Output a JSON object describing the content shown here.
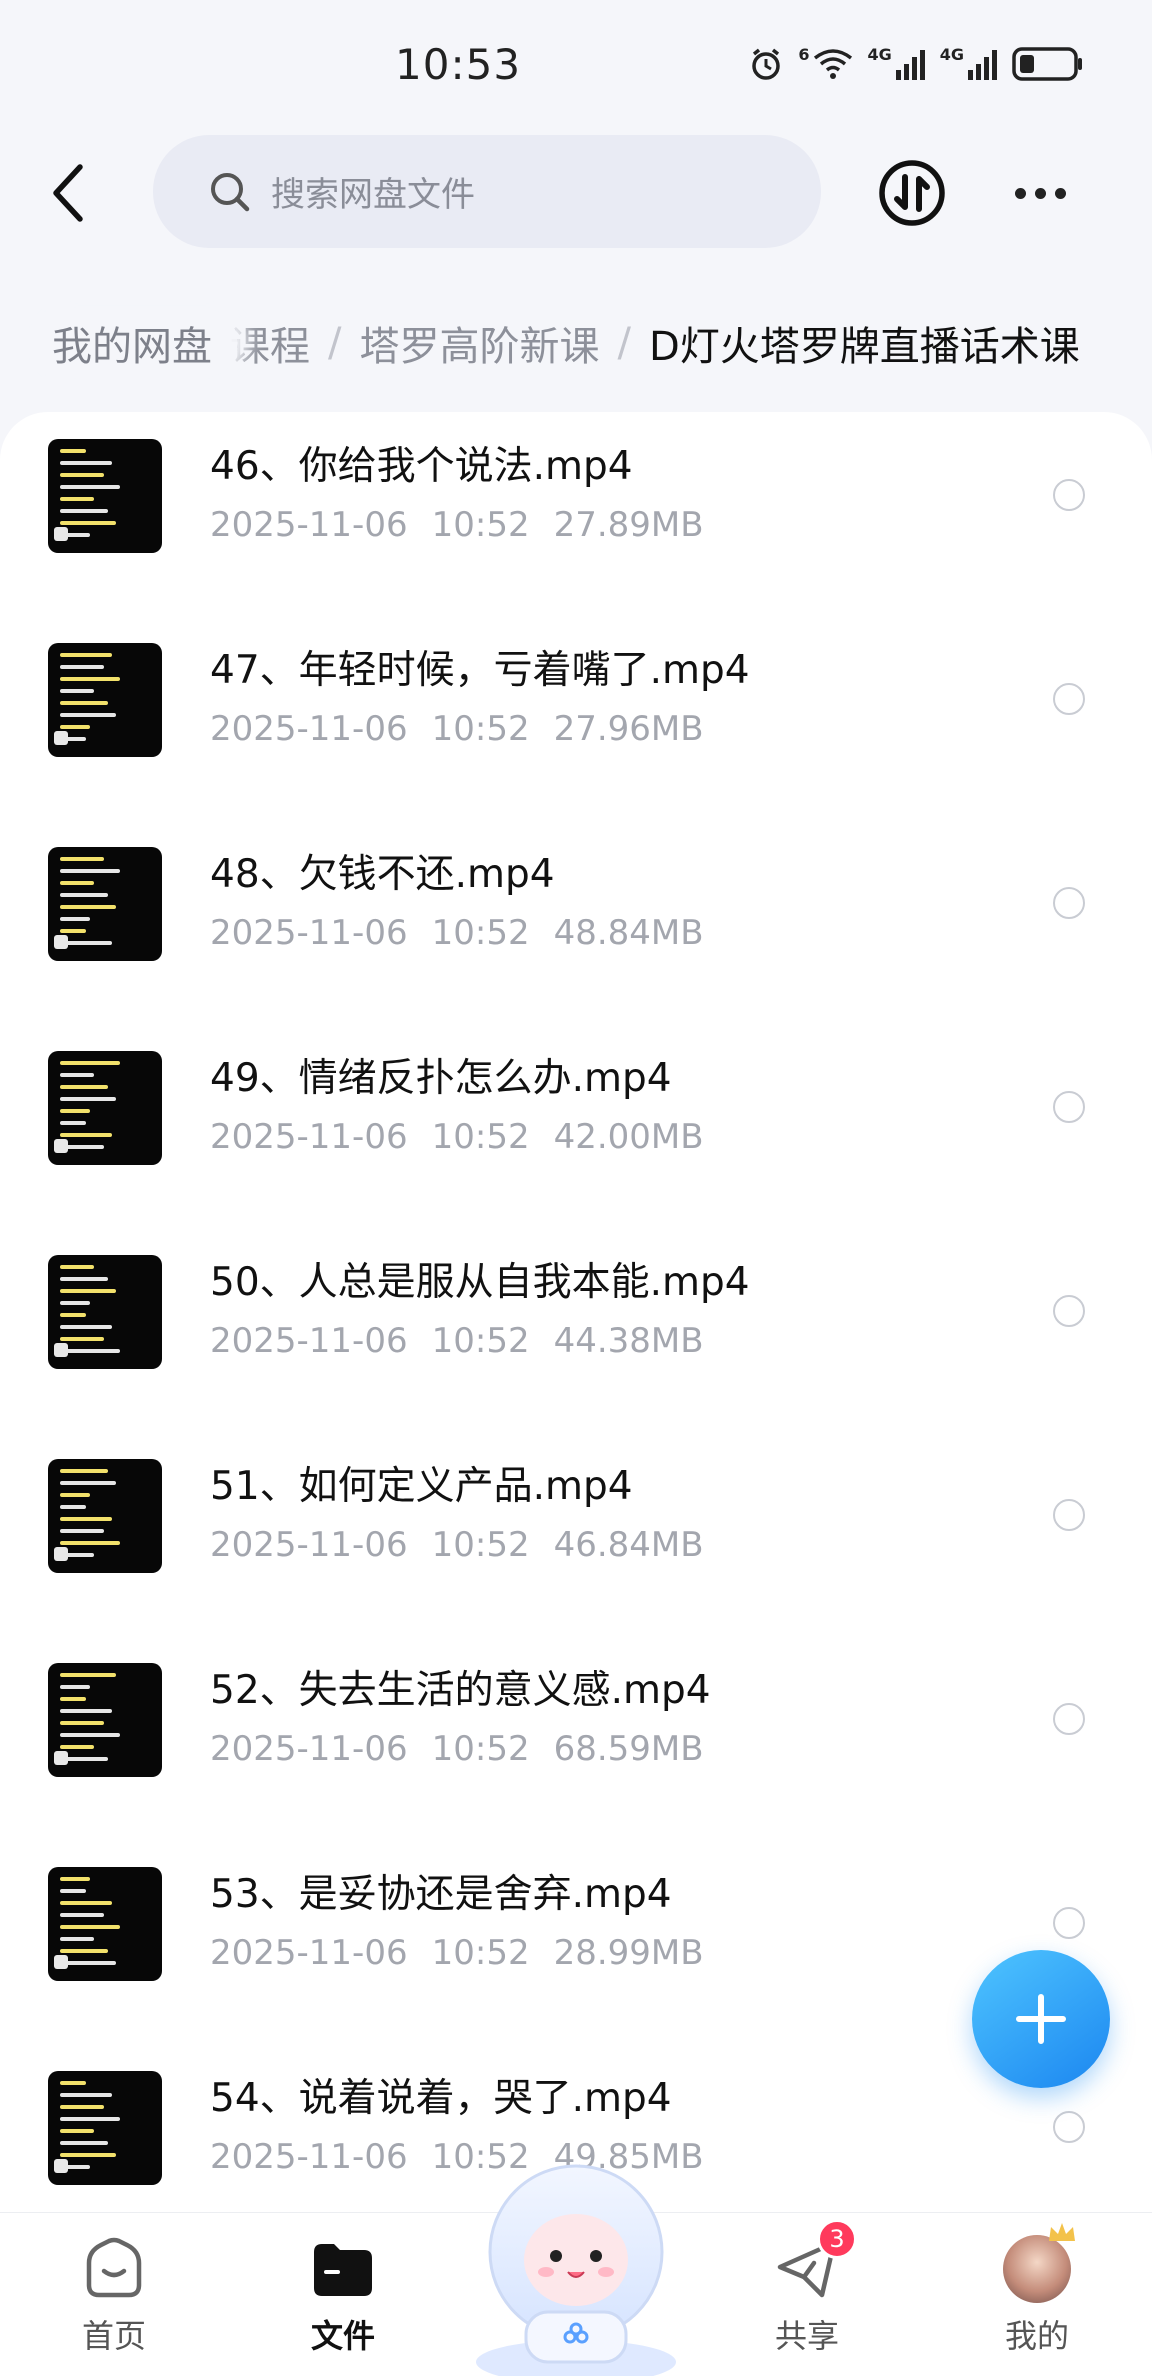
{
  "status_bar": {
    "time": "10:53",
    "network_1": "4G",
    "network_2": "4G",
    "wifi_label": "6",
    "icons": [
      "alarm-icon",
      "wifi-icon",
      "signal-icon",
      "signal-icon",
      "battery-icon"
    ]
  },
  "header": {
    "search_placeholder": "搜索网盘文件",
    "icons": [
      "back-arrow-icon",
      "search-icon",
      "transfer-icon",
      "more-icon"
    ]
  },
  "breadcrumb": {
    "root": "我的网盘",
    "trail_fragment": "课程",
    "separator": "/",
    "middle": "塔罗高阶新课",
    "current": "D灯火塔罗牌直播话术课"
  },
  "files": [
    {
      "name": "46、你给我个说法.mp4",
      "date": "2025-11-06",
      "time": "10:52",
      "size": "27.89MB"
    },
    {
      "name": "47、年轻时候，亏着嘴了.mp4",
      "date": "2025-11-06",
      "time": "10:52",
      "size": "27.96MB"
    },
    {
      "name": "48、欠钱不还.mp4",
      "date": "2025-11-06",
      "time": "10:52",
      "size": "48.84MB"
    },
    {
      "name": "49、情绪反扑怎么办.mp4",
      "date": "2025-11-06",
      "time": "10:52",
      "size": "42.00MB"
    },
    {
      "name": "50、人总是服从自我本能.mp4",
      "date": "2025-11-06",
      "time": "10:52",
      "size": "44.38MB"
    },
    {
      "name": "51、如何定义产品.mp4",
      "date": "2025-11-06",
      "time": "10:52",
      "size": "46.84MB"
    },
    {
      "name": "52、失去生活的意义感.mp4",
      "date": "2025-11-06",
      "time": "10:52",
      "size": "68.59MB"
    },
    {
      "name": "53、是妥协还是舍弃.mp4",
      "date": "2025-11-06",
      "time": "10:52",
      "size": "28.99MB"
    },
    {
      "name": "54、说着说着，哭了.mp4",
      "date": "2025-11-06",
      "time": "10:52",
      "size": "49.85MB"
    }
  ],
  "bottom_nav": {
    "items": [
      {
        "label": "首页",
        "icon": "home-icon",
        "active": false
      },
      {
        "label": "文件",
        "icon": "folder-icon",
        "active": true
      },
      {
        "label": "共享",
        "icon": "share-plane-icon",
        "active": false,
        "badge": "3"
      },
      {
        "label": "我的",
        "icon": "avatar",
        "active": false
      }
    ]
  },
  "colors": {
    "accent": "#1b86f0",
    "badge": "#ff3a5c",
    "background": "#f5f6fa",
    "meta_text": "#a3a6ae"
  }
}
